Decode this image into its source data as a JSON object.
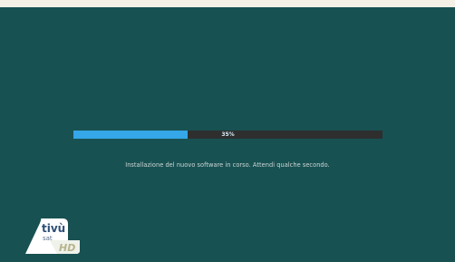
{
  "progress": {
    "percent_label": "35%",
    "fraction": 0.37
  },
  "status": {
    "message": "Installazione del nuovo software in corso. Attendi qualche secondo."
  },
  "logo": {
    "text_tivu": "tivù",
    "text_sat": "sat",
    "text_hd": "HD"
  }
}
